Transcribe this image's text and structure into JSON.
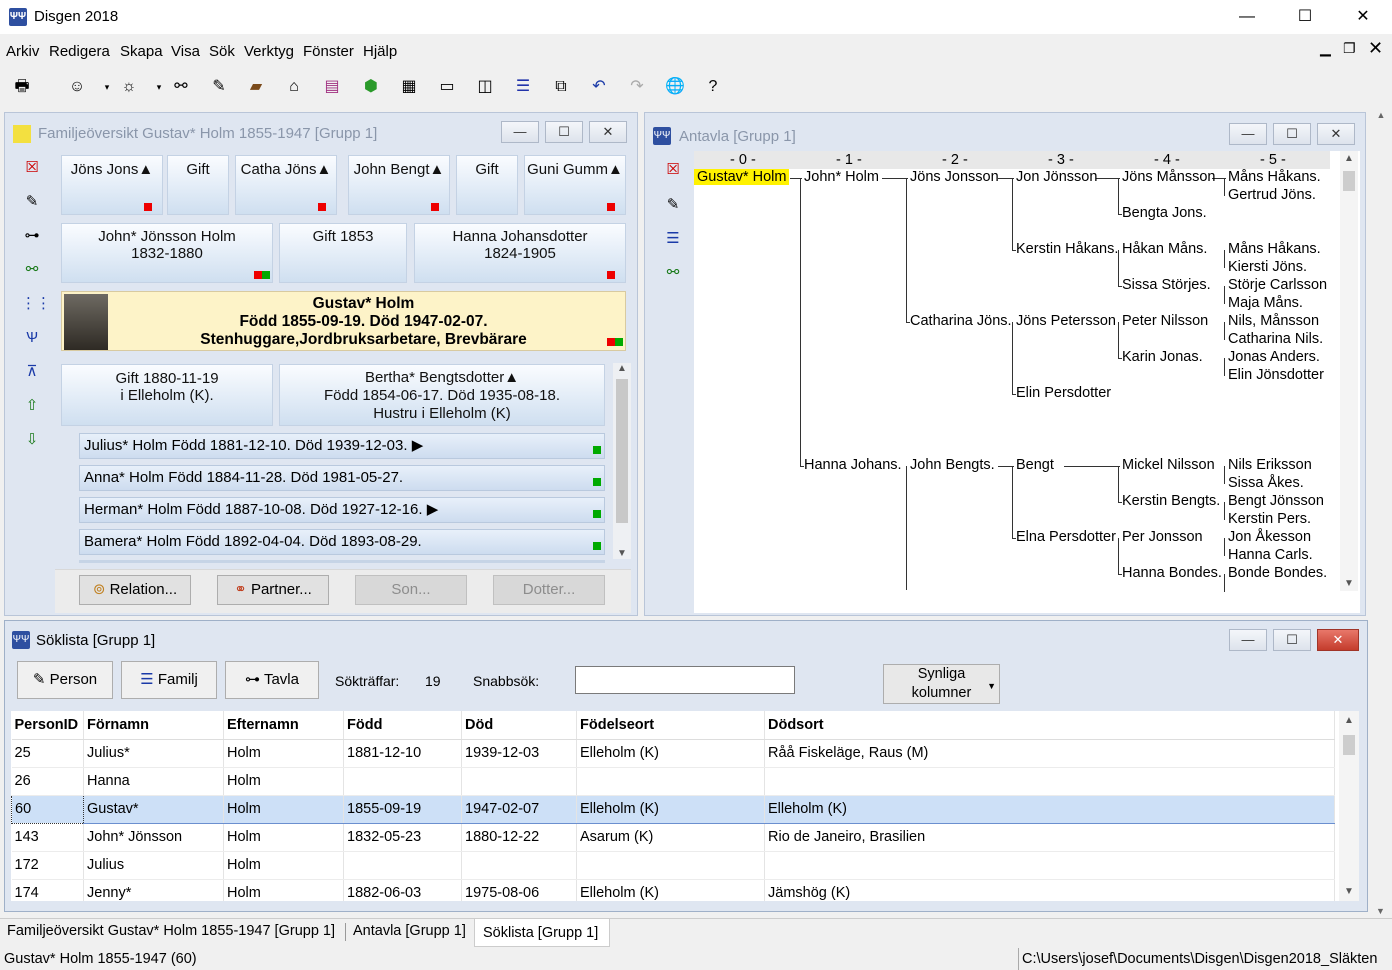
{
  "app": {
    "title": "Disgen 2018",
    "icon": "disgen-logo-icon"
  },
  "menu": {
    "items": [
      "Arkiv",
      "Redigera",
      "Skapa",
      "Visa",
      "Sök",
      "Verktyg",
      "Fönster",
      "Hjälp"
    ]
  },
  "family_window": {
    "title": "Familjeöversikt Gustav* Holm 1855-1947 [Grupp 1]",
    "grandparents": [
      {
        "label": "Jöns Jons▲"
      },
      {
        "label": "Gift"
      },
      {
        "label": "Catha Jöns▲"
      },
      {
        "label": "John Bengt▲"
      },
      {
        "label": "Gift"
      },
      {
        "label": "Guni Gumm▲"
      }
    ],
    "parents": {
      "father_name": "John* Jönsson Holm",
      "father_years": "1832-1880",
      "marriage": "Gift 1853",
      "mother_name": "Hanna Johansdotter",
      "mother_years": "1824-1905"
    },
    "main_person": {
      "name": "Gustav* Holm",
      "dates": "Född 1855-09-19. Död 1947-02-07.",
      "occupation": "Stenhuggare,Jordbruksarbetare, Brevbärare"
    },
    "spouse_marriage": {
      "line1": "Gift 1880-11-19",
      "line2": "i  Elleholm (K)."
    },
    "spouse": {
      "name": "Bertha* Bengtsdotter▲",
      "dates": "Född 1854-06-17. Död 1935-08-18.",
      "note": "Hustru  i Elleholm (K)"
    },
    "children": [
      "Julius* Holm Född 1881-12-10. Död 1939-12-03. ▶",
      "Anna* Holm Född 1884-11-28. Död 1981-05-27.",
      "Herman* Holm Född 1887-10-08. Död 1927-12-16. ▶",
      "Bamera* Holm Född 1892-04-04. Död 1893-08-29."
    ],
    "buttons": {
      "relation": "Relation...",
      "partner": "Partner...",
      "son": "Son...",
      "dotter": "Dotter..."
    }
  },
  "pedigree_window": {
    "title": "Antavla [Grupp 1]",
    "generations": [
      "- 0 -",
      "- 1 -",
      "- 2 -",
      "- 3 -",
      "- 4 -",
      "- 5 -"
    ],
    "gen0": "Gustav* Holm",
    "gen1": [
      "John* Holm",
      "Hanna Johans."
    ],
    "gen2": [
      "Jöns Jonsson",
      "Catharina Jöns.",
      "John Bengts."
    ],
    "gen3": [
      "Jon Jönsson",
      "Kerstin Håkans.",
      "Jöns Petersson",
      "Elin Persdotter",
      "Bengt",
      "Elna Persdotter"
    ],
    "gen4": [
      "Jöns Månsson",
      "Bengta Jons.",
      "Håkan Måns.",
      "Sissa Störjes.",
      "Peter Nilsson",
      "Karin Jonas.",
      "Mickel Nilsson",
      "Kerstin Bengts.",
      "Per Jonsson",
      "Hanna Bondes."
    ],
    "gen5": [
      "Måns Håkans.",
      "Gertrud Jöns.",
      "Måns Håkans.",
      "Kiersti Jöns.",
      "Störje Carlsson",
      "Maja Måns.",
      "Nils, Månsson",
      "Catharina Nils.",
      "Jonas Anders.",
      "Elin Jönsdotter",
      "Nils Eriksson",
      "Sissa Åkes.",
      "Bengt Jönsson",
      "Kerstin Pers.",
      "Jon Åkesson",
      "Hanna Carls.",
      "Bonde Bondes."
    ]
  },
  "search_window": {
    "title": "Söklista [Grupp 1]",
    "buttons": {
      "person": "Person",
      "familj": "Familj",
      "tavla": "Tavla"
    },
    "hits_label": "Sökträffar:",
    "hits_value": "19",
    "quick_label": "Snabbsök:",
    "quick_value": "",
    "columns_button_line1": "Synliga",
    "columns_button_line2": "kolumner",
    "columns": [
      "PersonID",
      "Förnamn",
      "Efternamn",
      "Född",
      "Död",
      "Födelseort",
      "Dödsort"
    ],
    "rows": [
      [
        "25",
        "Julius*",
        "Holm",
        "1881-12-10",
        "1939-12-03",
        "Elleholm (K)",
        "Råå Fiskeläge, Raus (M)"
      ],
      [
        "26",
        "Hanna",
        "Holm",
        "",
        "",
        "",
        ""
      ],
      [
        "60",
        "Gustav*",
        "Holm",
        "1855-09-19",
        "1947-02-07",
        "Elleholm (K)",
        "Elleholm (K)"
      ],
      [
        "143",
        "John* Jönsson",
        "Holm",
        "1832-05-23",
        "1880-12-22",
        "Asarum (K)",
        "Rio de Janeiro, Brasilien"
      ],
      [
        "172",
        "Julius",
        "Holm",
        "",
        "",
        "",
        ""
      ],
      [
        "174",
        "Jenny*",
        "Holm",
        "1882-06-03",
        "1975-08-06",
        "Elleholm (K)",
        "Jämshög (K)"
      ]
    ],
    "selected_row": 2
  },
  "tabs": [
    "Familjeöversikt Gustav* Holm 1855-1947 [Grupp 1]",
    "Antavla [Grupp 1]",
    "Söklista [Grupp 1]"
  ],
  "status": {
    "left": "Gustav* Holm 1855-1947 (60)",
    "right": "C:\\Users\\josef\\Documents\\Disgen\\Disgen2018_Släkten"
  }
}
